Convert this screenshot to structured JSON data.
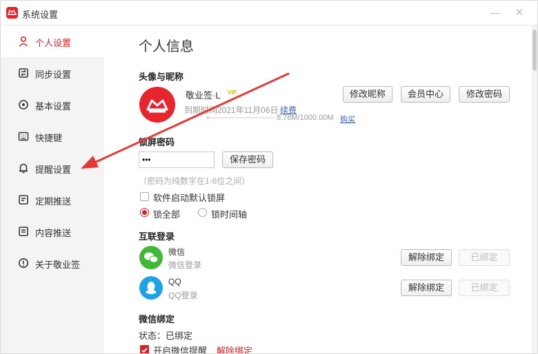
{
  "window": {
    "title": "系统设置"
  },
  "sidebar": {
    "items": [
      {
        "label": "个人设置",
        "icon": "user-icon",
        "active": true
      },
      {
        "label": "同步设置",
        "icon": "sync-icon"
      },
      {
        "label": "基本设置",
        "icon": "settings-icon"
      },
      {
        "label": "快捷键",
        "icon": "keyboard-icon"
      },
      {
        "label": "提醒设置",
        "icon": "bell-icon"
      },
      {
        "label": "定期推送",
        "icon": "calendar-icon"
      },
      {
        "label": "内容推送",
        "icon": "document-icon"
      },
      {
        "label": "关于敬业签",
        "icon": "info-icon"
      }
    ]
  },
  "main": {
    "title": "个人信息",
    "profile": {
      "section_title": "头像与昵称",
      "nickname": "敬业签·L",
      "vip_badge": "VIP",
      "expiry_label": "到期时间2021年11月06日",
      "renew_link": "续费",
      "storage_text": "8.76M/1000.00M",
      "storage_fraction": 0.00876,
      "buy_link": "购买",
      "buttons": {
        "rename": "修改昵称",
        "member": "会员中心",
        "password": "修改密码"
      }
    },
    "lock": {
      "section_title": "锁屏密码",
      "password_value": "•••",
      "save_button": "保存密码",
      "hint": "（密码为纯数字在1-6位之间）",
      "auto_lock_label": "软件启动默认锁屏",
      "auto_lock_checked": false,
      "radio_all": "锁全部",
      "radio_timeline": "锁时间轴"
    },
    "login": {
      "section_title": "互联登录",
      "accounts": [
        {
          "name": "微信",
          "status": "微信登录",
          "unbind": "解除绑定",
          "bound": "已绑定"
        },
        {
          "name": "QQ",
          "status": "QQ登录",
          "unbind": "解除绑定",
          "bound": "已绑定"
        }
      ]
    },
    "wechat_bind": {
      "section_title": "微信绑定",
      "status_text": "状态：已绑定",
      "remind_label": "开启微信提醒",
      "remind_checked": true,
      "unbind_link": "解除绑定"
    }
  },
  "colors": {
    "accent": "#d81e26",
    "wechat": "#3fb837",
    "qq": "#1ea1e7",
    "arrow": "#e53935"
  }
}
